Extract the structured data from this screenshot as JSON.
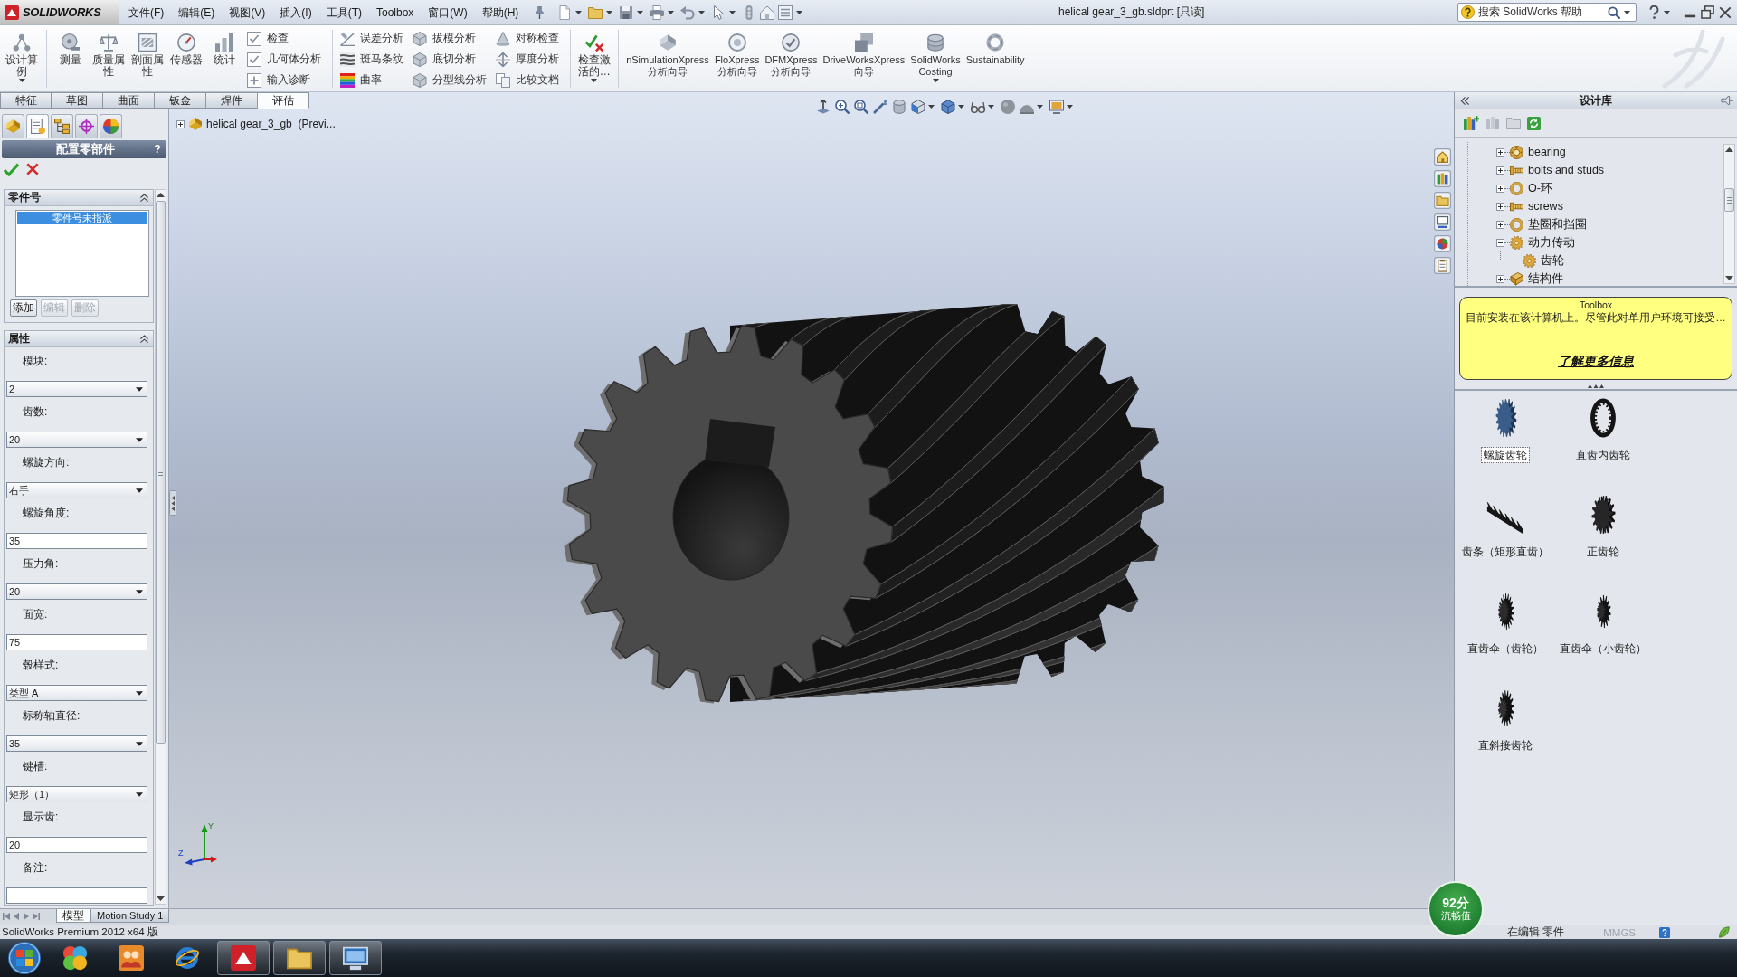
{
  "title_bar": {
    "logo": "SOLIDWORKS",
    "menu": [
      "文件(F)",
      "编辑(E)",
      "视图(V)",
      "插入(I)",
      "工具(T)",
      "Toolbox",
      "窗口(W)",
      "帮助(H)"
    ],
    "title": "helical gear_3_gb.sldprt [只读]",
    "search": {
      "placeholder": "搜索 SolidWorks 帮助"
    }
  },
  "ribbon": {
    "groups": [
      [
        {
          "kind": "tool",
          "label": "设计算例",
          "dropdown": true
        }
      ],
      [
        {
          "kind": "tool",
          "label": "测量",
          "dropdown": false
        },
        {
          "kind": "tool",
          "label": "质量属性",
          "dropdown": false
        },
        {
          "kind": "tool",
          "label": "剖面属性",
          "dropdown": false
        },
        {
          "kind": "tool",
          "label": "传感器",
          "dropdown": false
        },
        {
          "kind": "tool",
          "label": "统计",
          "dropdown": false
        },
        {
          "kind": "column",
          "buttons": [
            "检查",
            "几何体分析",
            "输入诊断"
          ]
        }
      ],
      [
        {
          "kind": "column",
          "buttons": [
            "误差分析",
            "斑马条纹",
            "曲率"
          ]
        },
        {
          "kind": "column",
          "buttons": [
            "拔模分析",
            "底切分析",
            "分型线分析"
          ]
        },
        {
          "kind": "column",
          "buttons": [
            "对称检查",
            "厚度分析",
            "比较文档"
          ]
        }
      ],
      [
        {
          "kind": "tool",
          "label": "检查激活的…",
          "dropdown": true
        }
      ],
      [
        {
          "kind": "wizard",
          "label": "nSimulationXpress 分析向导",
          "dropdown": false
        },
        {
          "kind": "wizard",
          "label": "FloXpress 分析向导",
          "dropdown": false
        },
        {
          "kind": "wizard",
          "label": "DFMXpress 分析向导",
          "dropdown": false
        },
        {
          "kind": "wizard",
          "label": "DriveWorksXpress 向导",
          "dropdown": false
        },
        {
          "kind": "wizard",
          "label": "SolidWorks Costing",
          "dropdown": true
        },
        {
          "kind": "wizard",
          "label": "Sustainability",
          "dropdown": false
        }
      ]
    ],
    "tabs": [
      {
        "label": "特征",
        "selected": false
      },
      {
        "label": "草图",
        "selected": false
      },
      {
        "label": "曲面",
        "selected": false
      },
      {
        "label": "钣金",
        "selected": false
      },
      {
        "label": "焊件",
        "selected": false
      },
      {
        "label": "评估",
        "selected": true
      }
    ]
  },
  "property_manager": {
    "panel_tabs": [
      {
        "selected": false
      },
      {
        "selected": true
      },
      {
        "selected": false
      },
      {
        "selected": false
      },
      {
        "selected": false
      }
    ],
    "title": "配置零部件",
    "help": "?",
    "sections": [
      {
        "kind": "part_numbers",
        "title": "零件号",
        "expanded": true,
        "list": [
          {
            "label": "零件号未指派",
            "selected": true
          }
        ],
        "buttons": [
          {
            "label": "添加",
            "disabled": false
          },
          {
            "label": "编辑",
            "disabled": true
          },
          {
            "label": "删除",
            "disabled": true
          }
        ]
      },
      {
        "kind": "properties",
        "title": "属性",
        "expanded": true,
        "fields": [
          {
            "label": "模块:",
            "kind": "dropdown",
            "value": "2"
          },
          {
            "label": "齿数:",
            "kind": "dropdown",
            "value": "20"
          },
          {
            "label": "螺旋方向:",
            "kind": "dropdown",
            "value": "右手"
          },
          {
            "label": "螺旋角度:",
            "kind": "input",
            "value": "35"
          },
          {
            "label": "压力角:",
            "kind": "dropdown",
            "value": "20"
          },
          {
            "label": "面宽:",
            "kind": "input",
            "value": "75"
          },
          {
            "label": "毂样式:",
            "kind": "dropdown",
            "value": "类型 A"
          },
          {
            "label": "标称轴直径:",
            "kind": "dropdown",
            "value": "35"
          },
          {
            "label": "键槽:",
            "kind": "dropdown",
            "value": "矩形（1）"
          },
          {
            "label": "显示齿:",
            "kind": "input",
            "value": "20"
          },
          {
            "label": "备注:",
            "kind": "input"
          }
        ]
      }
    ]
  },
  "viewport": {
    "tree": {
      "label": "helical gear_3_gb  (Previ...",
      "expanded": false
    },
    "triad": {
      "labels": [
        "Y",
        "Z"
      ]
    }
  },
  "design_library": {
    "title": "设计库",
    "tree": [
      {
        "label": "bearing",
        "expanded": false
      },
      {
        "label": "bolts and studs",
        "expanded": false
      },
      {
        "label": "O-环",
        "expanded": false
      },
      {
        "label": "screws",
        "expanded": false
      },
      {
        "label": "垫圈和挡圈",
        "expanded": false
      },
      {
        "label": "动力传动",
        "expanded": true,
        "children": [
          {
            "label": "齿轮"
          }
        ]
      },
      {
        "label": "结构件",
        "expanded": false
      }
    ],
    "notice": {
      "title": "Toolbox",
      "text": "目前安装在该计算机上。尽管此对单用户环境可接受…",
      "link": "了解更多信息"
    },
    "items": [
      {
        "label": "螺旋齿轮",
        "selected": true
      },
      {
        "label": "直齿内齿轮",
        "selected": false
      },
      {
        "label": "齿条（矩形直齿）",
        "selected": false
      },
      {
        "label": "正齿轮",
        "selected": false
      },
      {
        "label": "直齿伞（齿轮）",
        "selected": false
      },
      {
        "label": "直齿伞（小齿轮）",
        "selected": false
      },
      {
        "label": "直斜接齿轮",
        "selected": false
      }
    ]
  },
  "model_tabs": [
    {
      "label": "模型",
      "selected": true
    },
    {
      "label": "Motion Study 1",
      "selected": false
    }
  ],
  "status_bar": {
    "product": "SolidWorks Premium 2012 x64 版",
    "mode": "在编辑 零件",
    "units": "MMGS"
  },
  "perf_badge": {
    "score": "92分",
    "label": "流畅值"
  },
  "taskbar": {
    "apps": [
      {
        "running": false
      },
      {
        "running": false
      },
      {
        "running": false
      },
      {
        "running": true
      },
      {
        "running": true
      },
      {
        "running": true
      }
    ]
  }
}
